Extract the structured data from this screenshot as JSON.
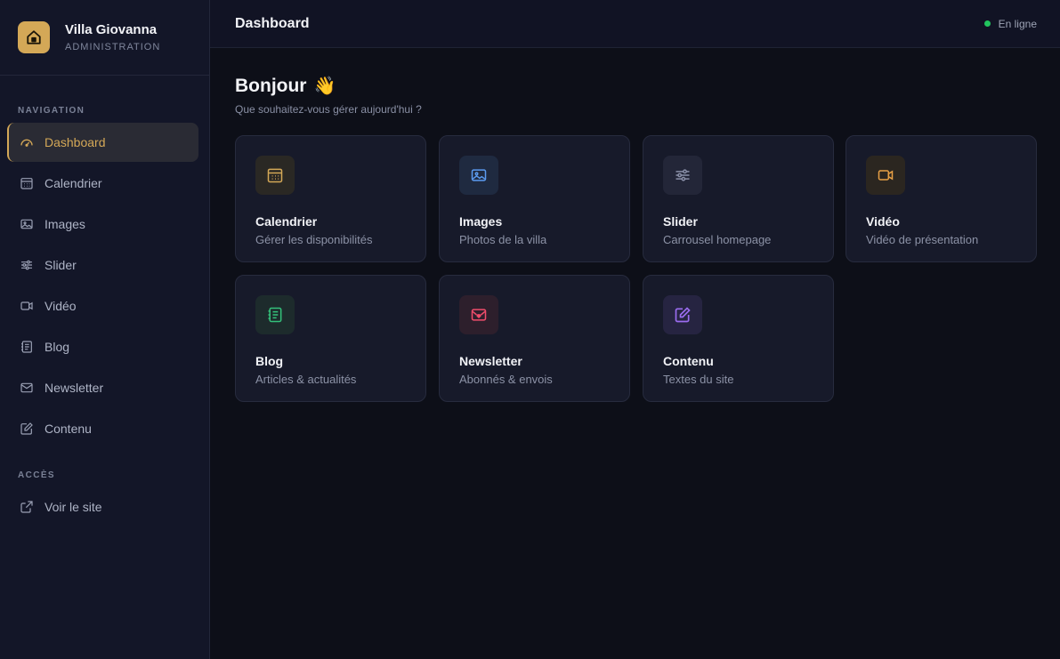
{
  "brand": {
    "name": "Villa Giovanna",
    "subtitle": "ADMINISTRATION",
    "icon": "home-icon",
    "accent": "#d4a857"
  },
  "sidebar": {
    "nav_label": "NAVIGATION",
    "items": [
      {
        "label": "Dashboard",
        "icon": "gauge-icon",
        "active": true
      },
      {
        "label": "Calendrier",
        "icon": "calendar-icon"
      },
      {
        "label": "Images",
        "icon": "image-icon"
      },
      {
        "label": "Slider",
        "icon": "sliders-icon"
      },
      {
        "label": "Vidéo",
        "icon": "video-icon"
      },
      {
        "label": "Blog",
        "icon": "notebook-icon"
      },
      {
        "label": "Newsletter",
        "icon": "mail-heart-icon"
      },
      {
        "label": "Contenu",
        "icon": "edit-icon"
      }
    ],
    "access_label": "ACCÈS",
    "access_items": [
      {
        "label": "Voir le site",
        "icon": "external-link-icon"
      }
    ]
  },
  "topbar": {
    "title": "Dashboard",
    "status": "En ligne",
    "status_color": "#22c55e"
  },
  "greeting": {
    "title": "Bonjour",
    "emoji": "👋",
    "subtitle": "Que souhaitez-vous gérer aujourd'hui ?"
  },
  "cards": [
    {
      "title": "Calendrier",
      "desc": "Gérer les disponibilités",
      "icon": "calendar-icon",
      "color": "#d4a857"
    },
    {
      "title": "Images",
      "desc": "Photos de la villa",
      "icon": "image-icon",
      "color": "#5b9bf0"
    },
    {
      "title": "Slider",
      "desc": "Carrousel homepage",
      "icon": "sliders-icon",
      "color": "#8a90a8"
    },
    {
      "title": "Vidéo",
      "desc": "Vidéo de présentation",
      "icon": "video-icon",
      "color": "#e8a045"
    },
    {
      "title": "Blog",
      "desc": "Articles & actualités",
      "icon": "notebook-icon",
      "color": "#34c17a"
    },
    {
      "title": "Newsletter",
      "desc": "Abonnés & envois",
      "icon": "mail-heart-icon",
      "color": "#ef4d6b"
    },
    {
      "title": "Contenu",
      "desc": "Textes du site",
      "icon": "edit-icon",
      "color": "#9b6cf0"
    }
  ]
}
